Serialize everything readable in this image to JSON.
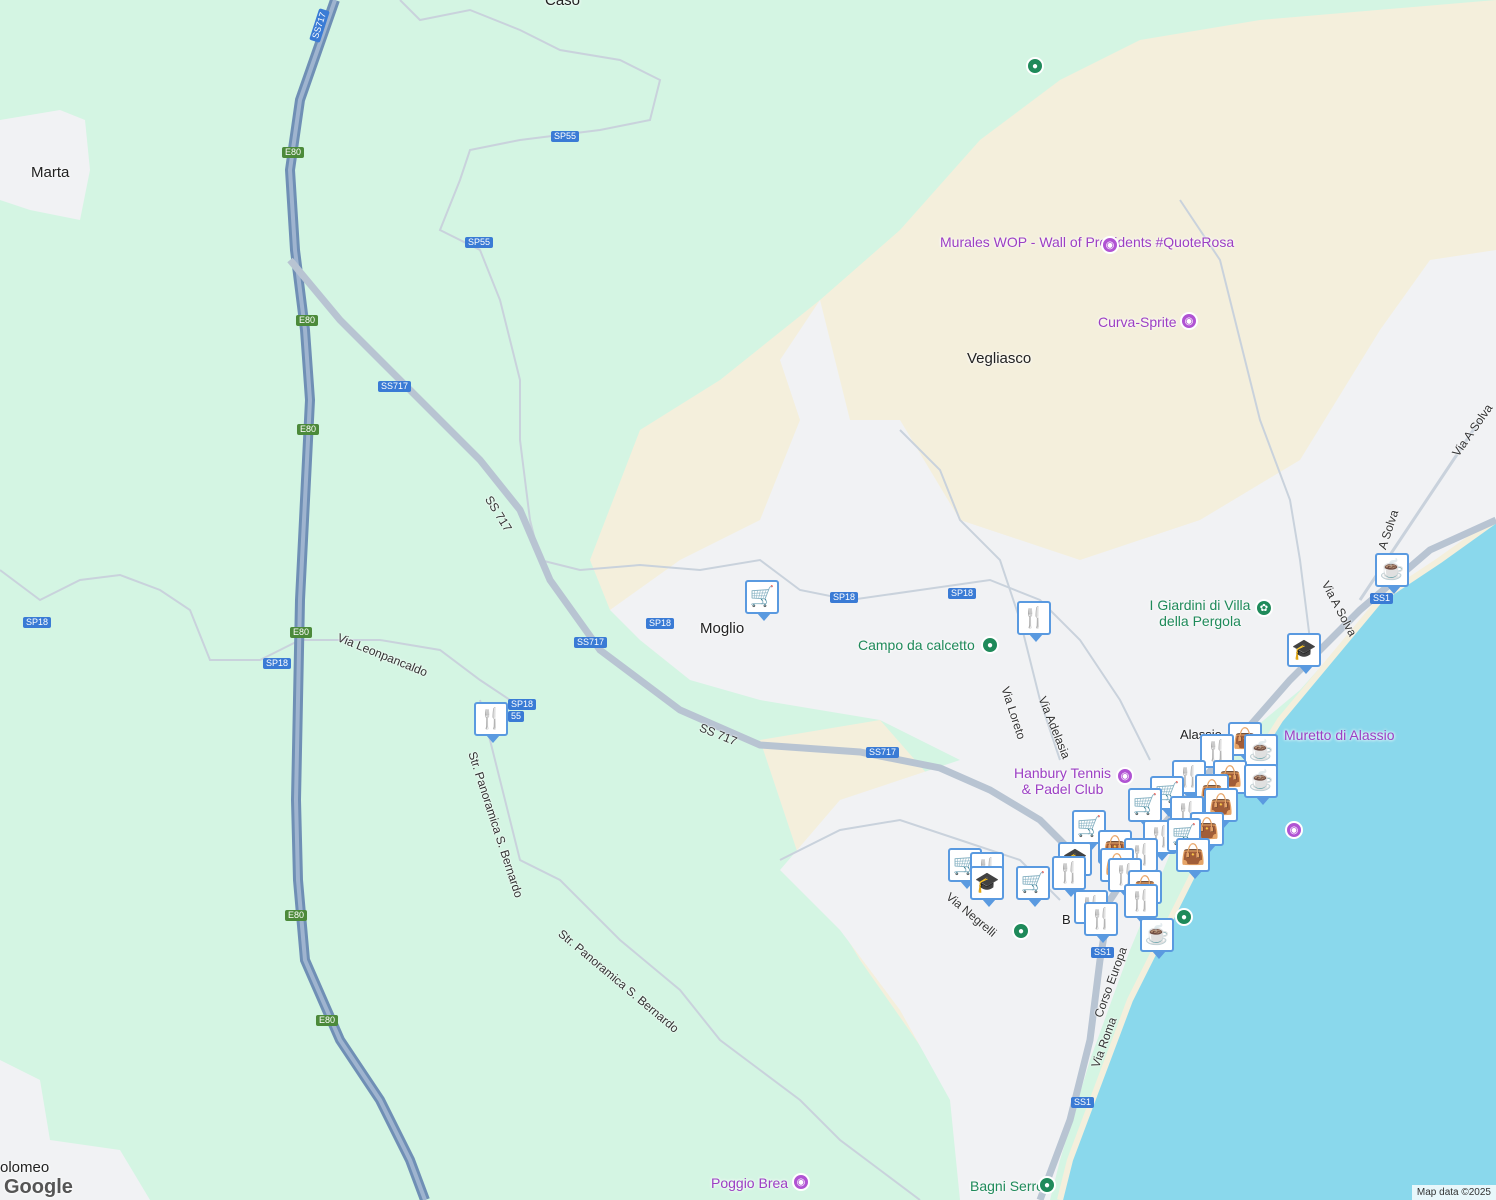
{
  "map": {
    "colors": {
      "forest": "#d4f5e3",
      "land": "#f6f1e2",
      "urban": "#f1f2f4",
      "sea": "#8ad8ec",
      "highway": "#6f8fb5",
      "road": "#b8c4d2"
    },
    "places": {
      "caso": "Caso",
      "marta": "Marta",
      "vegliasco": "Vegliasco",
      "moglio": "Moglio",
      "alassio": "Alassio",
      "bartolomeo": "olomeo",
      "b": "B"
    },
    "pois": {
      "murales": "Murales WOP - Wall of Presidents #QuoteRosa",
      "curva": "Curva-Sprite",
      "giardini": "I Giardini di Villa della Pergola",
      "calcetto": "Campo da calcetto",
      "hanbury": "Hanbury Tennis & Padel Club",
      "muretto": "Muretto di Alassio",
      "bagni": "Bagni Serre",
      "poggio": "Poggio Brea"
    },
    "streets": {
      "leonpancaldo": "Via Leonpancaldo",
      "panoramica1": "Str. Panoramica S. Bernardo",
      "panoramica2": "Str. Panoramica S. Bernardo",
      "ss717a": "SS 717",
      "ss717b": "SS 717",
      "loreto": "Via Loreto",
      "adelasia": "Via Adelasia",
      "negrelli": "Via Negrelli",
      "corso": "Corso Europa",
      "roma": "Via Roma",
      "asolva1": "Via A Solva",
      "asolva2": "Via A Solva",
      "asolva3": "A Solva"
    },
    "shields": {
      "s1": "SS717",
      "s2": "E80",
      "s3": "SP55",
      "s4": "SP55",
      "s5": "E80",
      "s6": "SS717",
      "s7": "E80",
      "s8": "SP18",
      "s9": "E80",
      "s10": "SP18",
      "s11": "SP18",
      "s12": "SS717",
      "s13": "SP18",
      "s14": "SP18",
      "s15": "SP18",
      "s16": "SS717",
      "s17": "E80",
      "s18": "E80",
      "s19": "SS1",
      "s20": "SS1",
      "s21": "SS1",
      "s22": "55"
    },
    "attribution": "Map data ©2025",
    "logo": "Google"
  }
}
